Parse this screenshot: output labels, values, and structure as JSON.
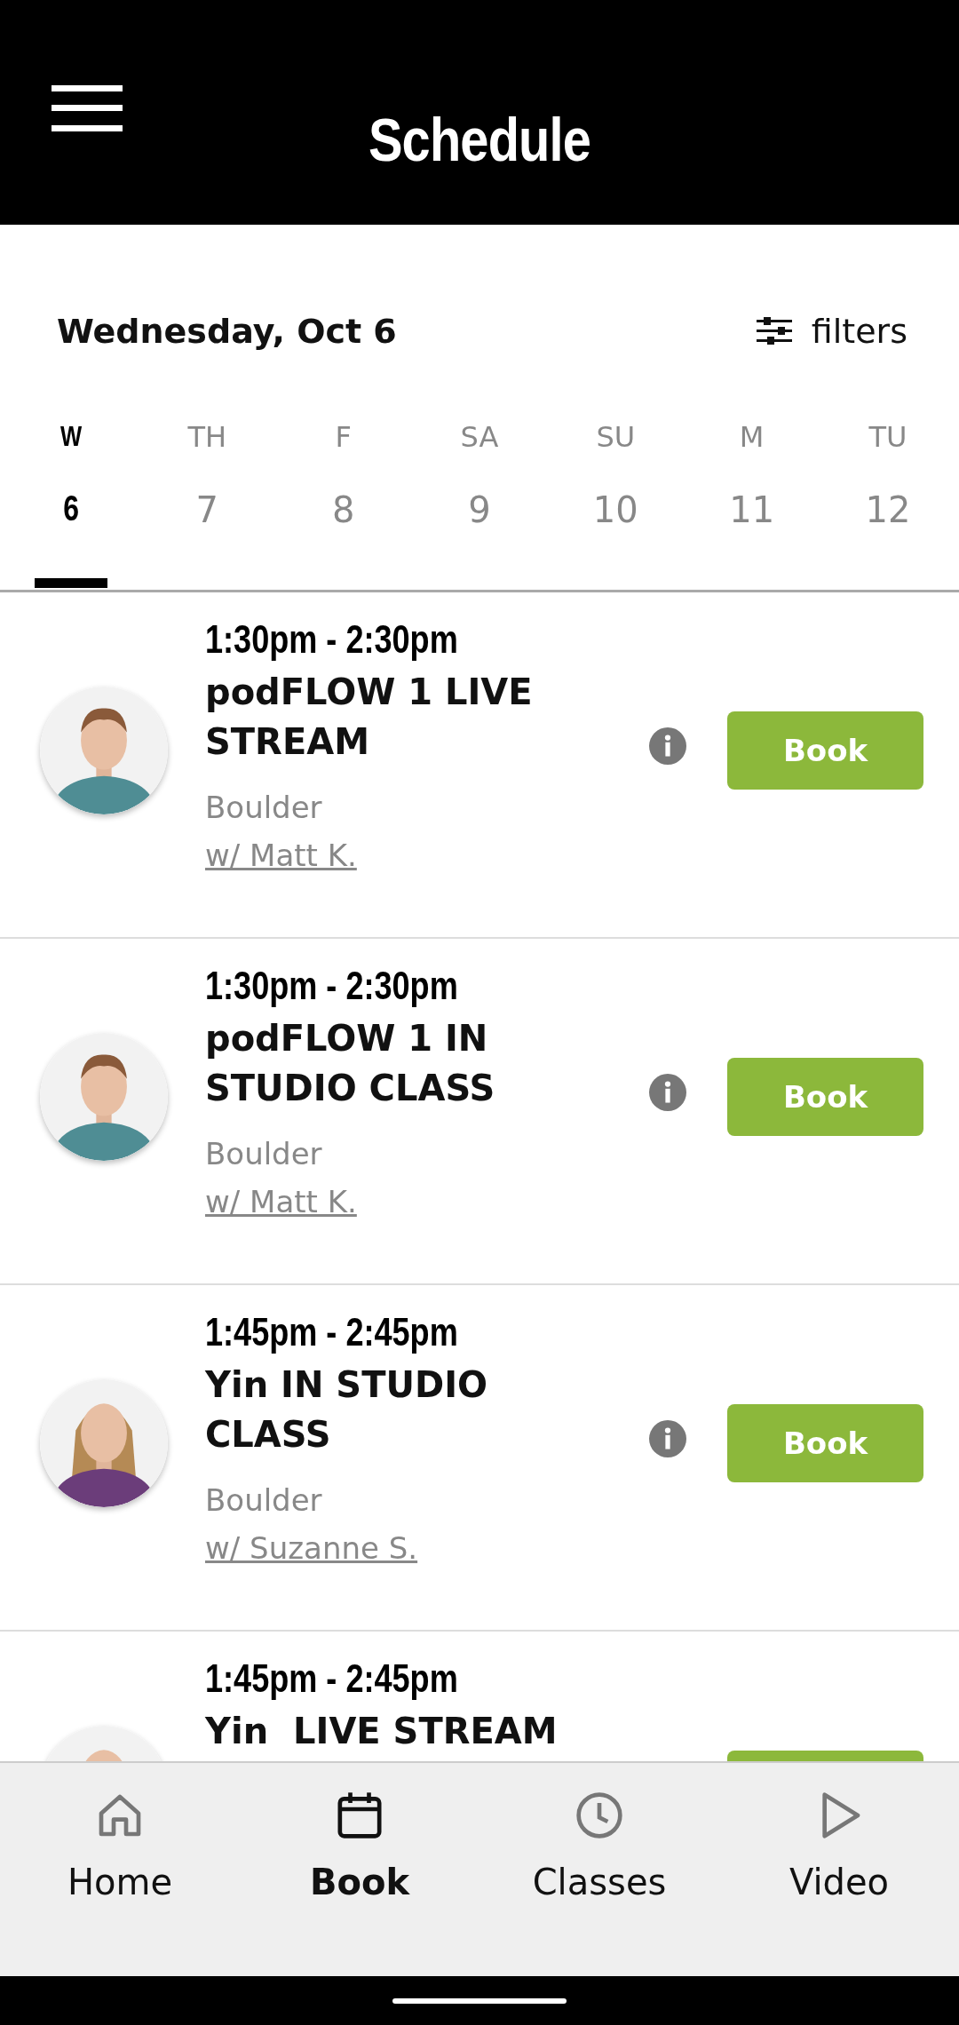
{
  "header": {
    "title": "Schedule"
  },
  "date_bar": {
    "date": "Wednesday, Oct 6",
    "filters_label": "filters"
  },
  "days": [
    {
      "weekday": "W",
      "day": "6",
      "selected": true
    },
    {
      "weekday": "TH",
      "day": "7",
      "selected": false
    },
    {
      "weekday": "F",
      "day": "8",
      "selected": false
    },
    {
      "weekday": "SA",
      "day": "9",
      "selected": false
    },
    {
      "weekday": "SU",
      "day": "10",
      "selected": false
    },
    {
      "weekday": "M",
      "day": "11",
      "selected": false
    },
    {
      "weekday": "TU",
      "day": "12",
      "selected": false
    }
  ],
  "classes": [
    {
      "time": "1:30pm - 2:30pm",
      "title": "podFLOW 1 LIVE STREAM",
      "location": "Boulder",
      "instructor": "w/ Matt K.",
      "button": "Book"
    },
    {
      "time": "1:30pm - 2:30pm",
      "title": "podFLOW 1 IN STUDIO CLASS",
      "location": "Boulder",
      "instructor": "w/ Matt K.",
      "button": "Book"
    },
    {
      "time": "1:45pm - 2:45pm",
      "title": "Yin IN STUDIO CLASS",
      "location": "Boulder",
      "instructor": "w/ Suzanne S.",
      "button": "Book"
    },
    {
      "time": "1:45pm - 2:45pm",
      "title": "Yin  LIVE STREAM"
    }
  ],
  "nav": [
    {
      "kind": "home",
      "label": "Home",
      "selected": false
    },
    {
      "kind": "calendar",
      "label": "Book",
      "selected": true
    },
    {
      "kind": "clock",
      "label": "Classes",
      "selected": false
    },
    {
      "kind": "play",
      "label": "Video",
      "selected": false
    }
  ]
}
